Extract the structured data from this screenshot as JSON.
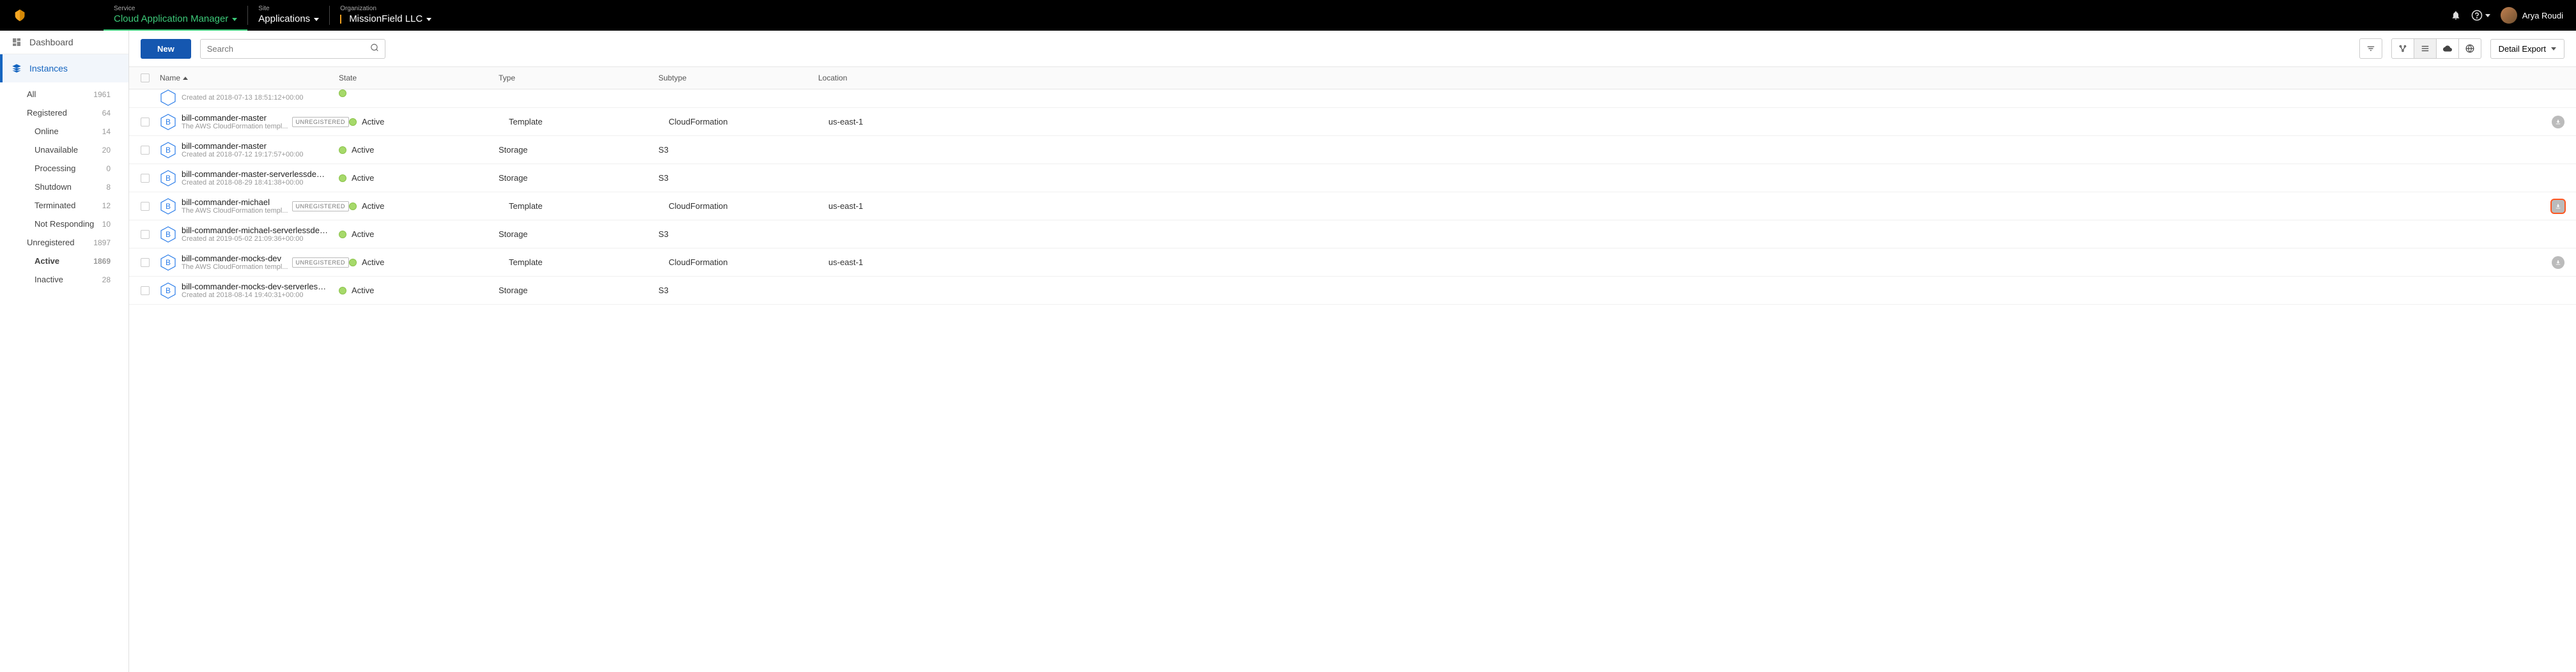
{
  "header": {
    "service_label": "Service",
    "service_value": "Cloud Application Manager",
    "site_label": "Site",
    "site_value": "Applications",
    "org_label": "Organization",
    "org_value": "MissionField LLC",
    "username": "Arya Roudi"
  },
  "sidebar": {
    "dashboard": "Dashboard",
    "instances": "Instances",
    "filters": [
      {
        "label": "All",
        "count": "1961",
        "level": 1
      },
      {
        "label": "Registered",
        "count": "64",
        "level": 1
      },
      {
        "label": "Online",
        "count": "14",
        "level": 2
      },
      {
        "label": "Unavailable",
        "count": "20",
        "level": 2
      },
      {
        "label": "Processing",
        "count": "0",
        "level": 2
      },
      {
        "label": "Shutdown",
        "count": "8",
        "level": 2
      },
      {
        "label": "Terminated",
        "count": "12",
        "level": 2
      },
      {
        "label": "Not Responding",
        "count": "10",
        "level": 2
      },
      {
        "label": "Unregistered",
        "count": "1897",
        "level": 1
      },
      {
        "label": "Active",
        "count": "1869",
        "level": 2,
        "bold": true
      },
      {
        "label": "Inactive",
        "count": "28",
        "level": 2
      }
    ]
  },
  "toolbar": {
    "new_label": "New",
    "search_placeholder": "Search",
    "export_label": "Detail Export"
  },
  "columns": {
    "name": "Name",
    "state": "State",
    "type": "Type",
    "subtype": "Subtype",
    "location": "Location"
  },
  "partial_row_secondary": "Created at 2018-07-13 18:51:12+00:00",
  "rows": [
    {
      "name": "bill-commander-master",
      "secondary": "The AWS CloudFormation templ...",
      "badge": "UNREGISTERED",
      "state": "Active",
      "type": "Template",
      "subtype": "CloudFormation",
      "location": "us-east-1",
      "action": true
    },
    {
      "name": "bill-commander-master",
      "secondary": "Created at 2018-07-12 19:17:57+00:00",
      "state": "Active",
      "type": "Storage",
      "subtype": "S3",
      "location": ""
    },
    {
      "name": "bill-commander-master-serverlessdeploymentb...",
      "secondary": "Created at 2018-08-29 18:41:38+00:00",
      "state": "Active",
      "type": "Storage",
      "subtype": "S3",
      "location": "",
      "wider": true
    },
    {
      "name": "bill-commander-michael",
      "secondary": "The AWS CloudFormation templ...",
      "badge": "UNREGISTERED",
      "state": "Active",
      "type": "Template",
      "subtype": "CloudFormation",
      "location": "us-east-1",
      "action": true,
      "highlight": true
    },
    {
      "name": "bill-commander-michael-serverlessdeploymentb...",
      "secondary": "Created at 2019-05-02 21:09:36+00:00",
      "state": "Active",
      "type": "Storage",
      "subtype": "S3",
      "location": "",
      "wider": true
    },
    {
      "name": "bill-commander-mocks-dev",
      "secondary": "The AWS CloudFormation templ...",
      "badge": "UNREGISTERED",
      "state": "Active",
      "type": "Template",
      "subtype": "CloudFormation",
      "location": "us-east-1",
      "action": true
    },
    {
      "name": "bill-commander-mocks-dev-serverlessdeployme...",
      "secondary": "Created at 2018-08-14 19:40:31+00:00",
      "state": "Active",
      "type": "Storage",
      "subtype": "S3",
      "location": "",
      "wider": true
    }
  ]
}
